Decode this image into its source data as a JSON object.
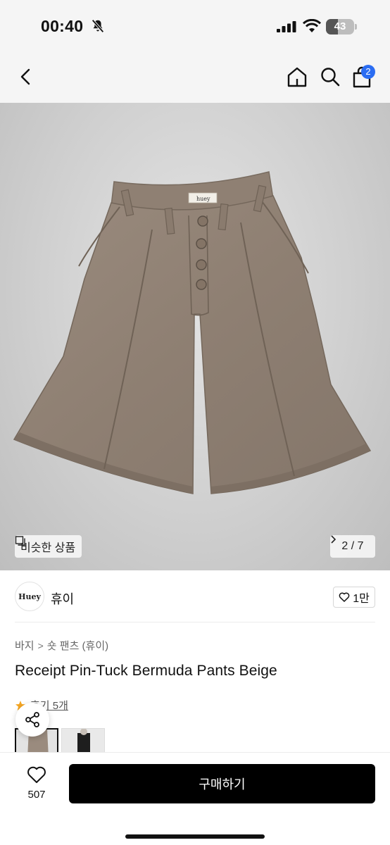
{
  "status_bar": {
    "time": "00:40",
    "battery": "43",
    "battery_level": 0.43
  },
  "nav": {
    "cart_count": "2"
  },
  "gallery": {
    "similar_label": "비슷한 상품",
    "counter": "2 / 7",
    "tag_text": "huey"
  },
  "brand": {
    "logo_text": "Huey",
    "name": "휴이",
    "likes": "1만"
  },
  "breadcrumb": {
    "category": "바지",
    "subcategory": "숏 팬츠 (휴이)"
  },
  "product": {
    "title": "Receipt Pin-Tuck Bermuda Pants Beige",
    "reviews": "후기 5개"
  },
  "bottom": {
    "wish_count": "507",
    "buy_label": "구매하기"
  },
  "colors": {
    "accent_badge": "#2b6df2",
    "buy_button": "#000000",
    "star": "#f5a623"
  }
}
